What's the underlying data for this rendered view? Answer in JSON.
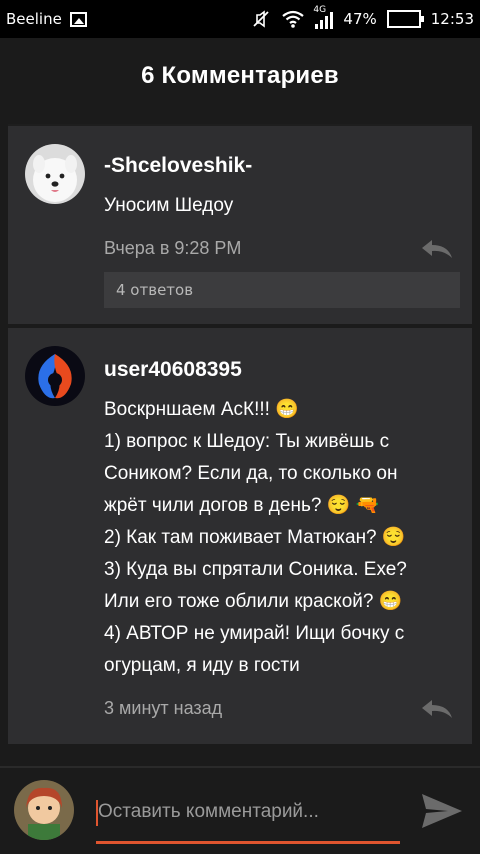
{
  "status_bar": {
    "carrier": "Beeline",
    "network": "4G",
    "battery": "47%",
    "time": "12:53"
  },
  "header": {
    "title": "6 Комментариев"
  },
  "comments": [
    {
      "author": "-Shceloveshik-",
      "lines": [
        "Уносим Шедоу"
      ],
      "time": "Вчера в 9:28 PM",
      "replies": "4 ответов"
    },
    {
      "author": "user40608395",
      "lines": [
        "Воскрншаем АсК!!! 😁",
        "1) вопрос к Шедоу: Ты живёшь с",
        "Соником? Если да, то сколько он",
        "жрёт чили догов в день? 😌 🔫",
        "2) Как там поживает Матюкан? 😌",
        "3) Куда вы спрятали Соника. Ехе?",
        "Или его тоже облили краской? 😁",
        "4) АВТОР не умирай! Ищи бочку с",
        "огурцам, я иду в гости"
      ],
      "time": "3 минут назад"
    }
  ],
  "composer": {
    "placeholder": "Оставить комментарий..."
  },
  "colors": {
    "accent": "#e0552f",
    "card": "#2e2e30",
    "bg": "#1b1b1b"
  }
}
